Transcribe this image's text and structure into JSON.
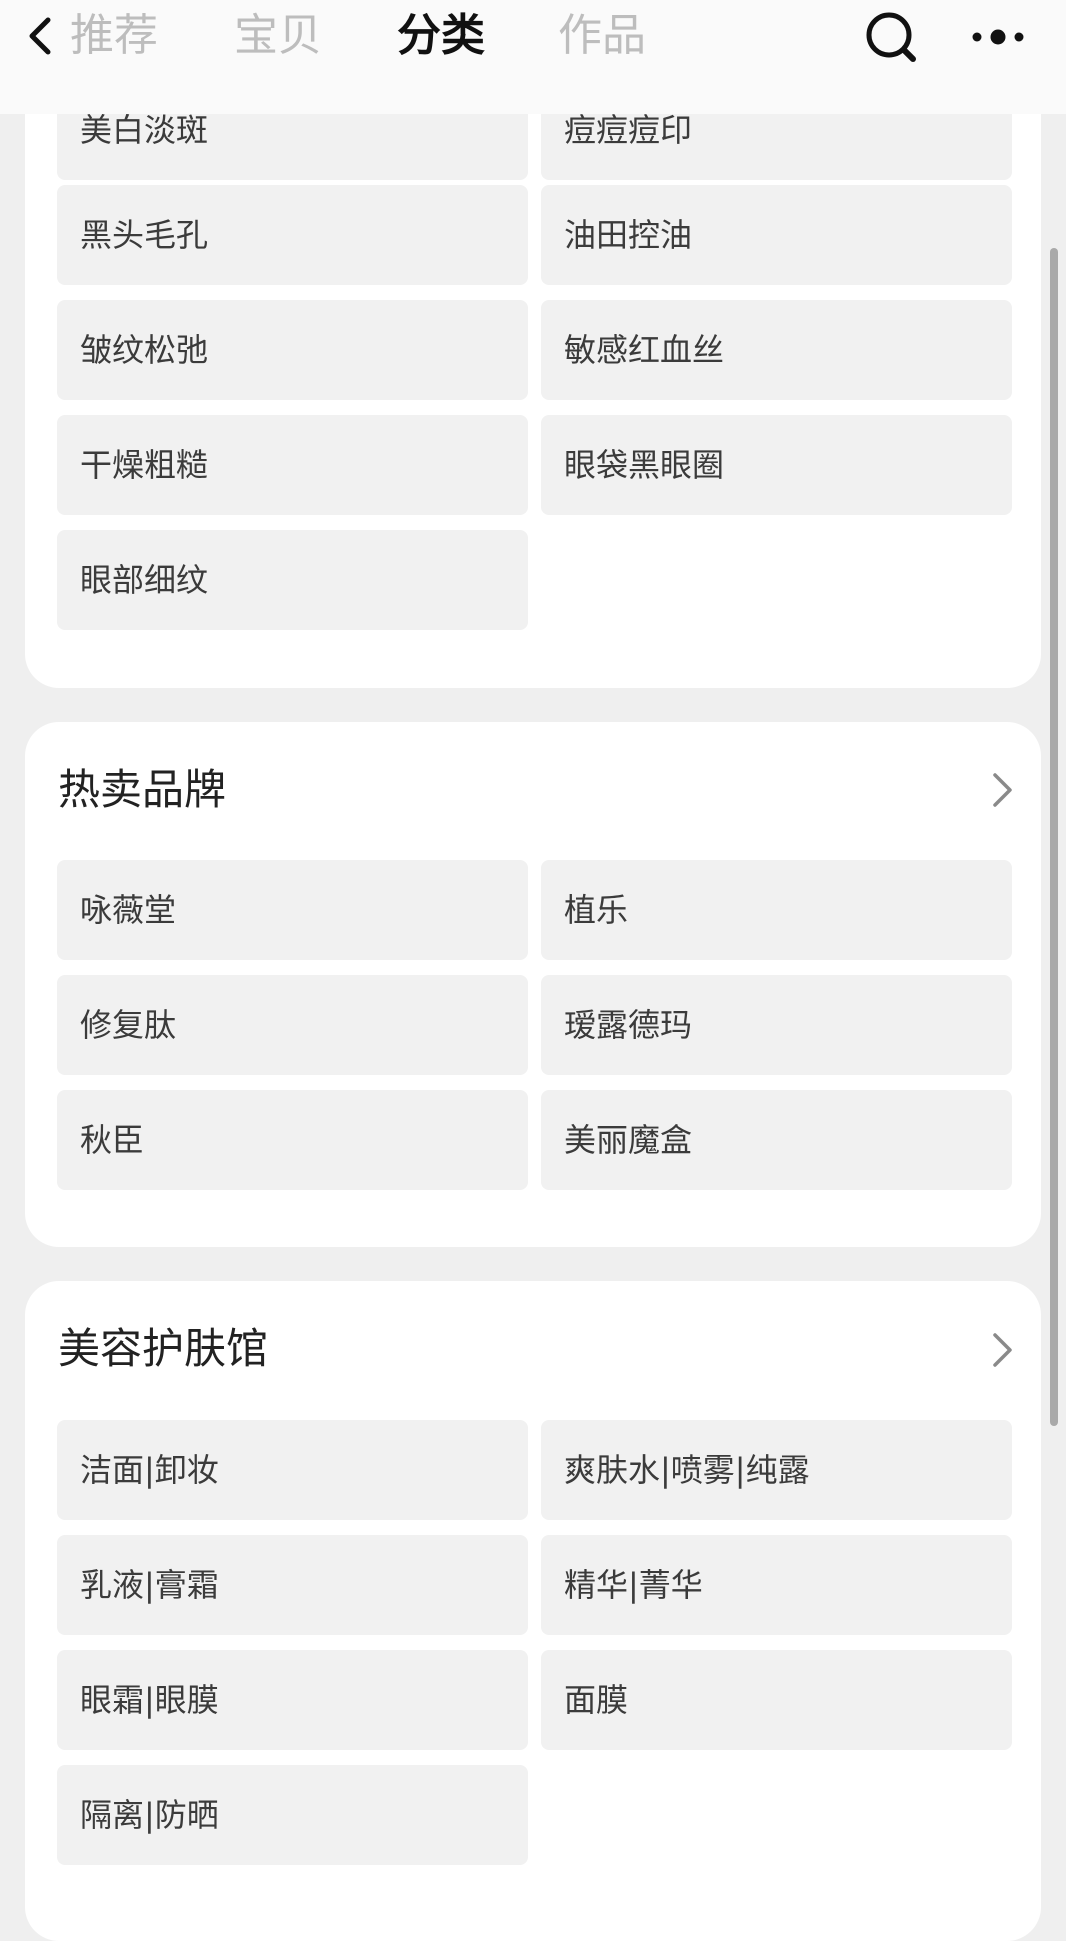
{
  "nav": {
    "tabs": [
      {
        "label": "推荐",
        "active": false
      },
      {
        "label": "宝贝",
        "active": false
      },
      {
        "label": "分类",
        "active": true
      },
      {
        "label": "作品",
        "active": false
      }
    ],
    "icons": {
      "back": "chevron-left-icon",
      "search": "search-icon",
      "more": "more-dots-icon"
    }
  },
  "skin_concerns": {
    "items": [
      "美白淡斑",
      "痘痘痘印",
      "黑头毛孔",
      "油田控油",
      "皱纹松弛",
      "敏感红血丝",
      "干燥粗糙",
      "眼袋黑眼圈",
      "眼部细纹"
    ]
  },
  "hot_brands": {
    "title": "热卖品牌",
    "items": [
      "咏薇堂",
      "植乐",
      "修复肽",
      "瑷露德玛",
      "秋臣",
      "美丽魔盒"
    ]
  },
  "beauty_hall": {
    "title": "美容护肤馆",
    "items": [
      "洁面|卸妆",
      "爽肤水|喷雾|纯露",
      "乳液|膏霜",
      "精华|菁华",
      "眼霜|眼膜",
      "面膜",
      "隔离|防晒"
    ]
  },
  "colors": {
    "page_bg": "#efefef",
    "card_bg": "#ffffff",
    "tile_bg": "#f1f1f1",
    "tab_active": "#111111",
    "tab_inactive": "#bdbdbd",
    "tile_text": "#3b3b3b"
  }
}
